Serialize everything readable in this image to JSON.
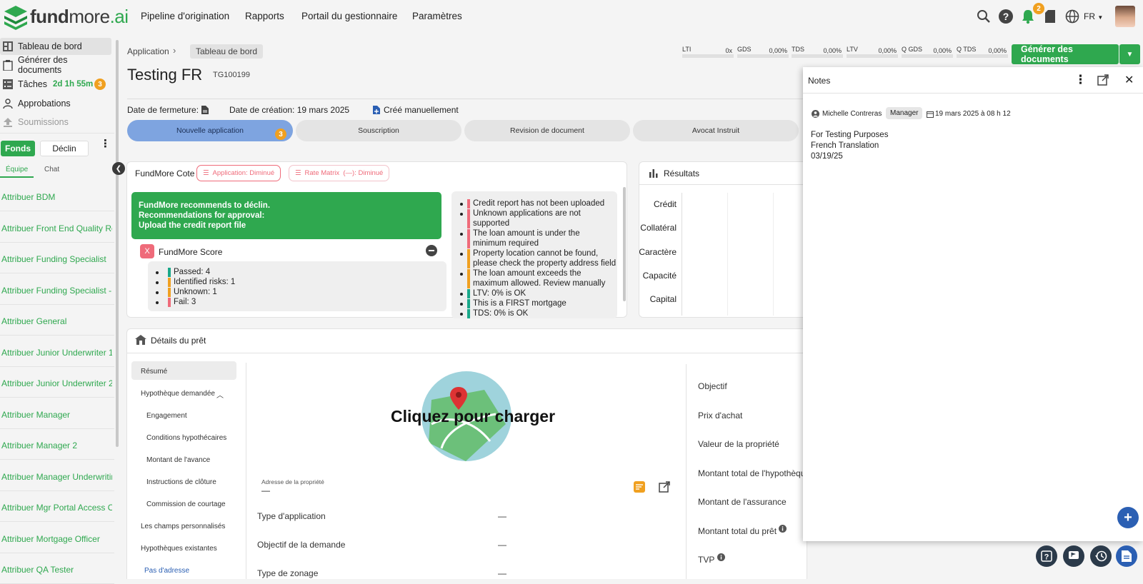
{
  "brand": {
    "name_bold": "fund",
    "name_mid": "more",
    "name_ai": ".ai"
  },
  "topnav": [
    "Pipeline d'origination",
    "Rapports",
    "Portail du gestionnaire",
    "Paramètres"
  ],
  "header_right": {
    "notif_count": "2",
    "lang": "FR"
  },
  "sidebar": {
    "items": [
      "Tableau de bord",
      "Générer des documents",
      "Tâches",
      "Approbations",
      "Soumissions"
    ],
    "tasks_timer": "2d 1h 55m",
    "tasks_count": "3",
    "fund_btn": "Fonds",
    "decline_btn": "Déclin",
    "tabs": [
      "Équipe",
      "Chat"
    ],
    "assignees": [
      "Attribuer BDM",
      "Attribuer Front End Quality Review",
      "Attribuer Funding Specialist",
      "Attribuer Funding Specialist - c",
      "Attribuer General",
      "Attribuer Junior Underwriter 1",
      "Attribuer Junior Underwriter 2",
      "Attribuer Manager",
      "Attribuer Manager 2",
      "Attribuer Manager Underwriting",
      "Attribuer Mgr Portal Access Only",
      "Attribuer Mortgage Officer",
      "Attribuer QA Tester"
    ]
  },
  "breadcrumb": {
    "root": "Application",
    "current": "Tableau de bord"
  },
  "ratios": [
    {
      "label": "LTI",
      "value": "0x"
    },
    {
      "label": "GDS",
      "value": "0,00%"
    },
    {
      "label": "TDS",
      "value": "0,00%"
    },
    {
      "label": "LTV",
      "value": "0,00%"
    },
    {
      "label": "Q GDS",
      "value": "0,00%"
    },
    {
      "label": "Q TDS",
      "value": "0,00%"
    }
  ],
  "generate_btn": "Générer des documents",
  "app": {
    "title": "Testing FR",
    "code": "TG100199",
    "closing_label": "Date de fermeture:",
    "created_label": "Date de création: 19 mars 2025",
    "manual_label": "Créé manuellement"
  },
  "stages": [
    {
      "label": "Nouvelle application",
      "count": "3"
    },
    {
      "label": "Souscription"
    },
    {
      "label": "Revision de document"
    },
    {
      "label": "Avocat Instruit"
    }
  ],
  "fundmore": {
    "title": "FundMore Cote",
    "chip1_label": "Application:",
    "chip1_value": "Diminué",
    "chip2_label": "Rate Matrix",
    "chip2_mid": "(—):",
    "chip2_value": "Diminué",
    "rec_lines": [
      "FundMore recommends to déclin.",
      "Recommendations for approval:",
      "Upload the credit report file"
    ],
    "score_title": "FundMore Score",
    "score_x": "X",
    "score_items": [
      {
        "text": "Passed: 4",
        "color": "#1aa88a"
      },
      {
        "text": "Identified risks: 1",
        "color": "#f0a020"
      },
      {
        "text": "Unknown: 1",
        "color": "#f0a020"
      },
      {
        "text": "Fail: 3",
        "color": "#ef6b7a"
      }
    ],
    "checks": [
      {
        "lines": [
          "Credit report has not been uploaded"
        ],
        "color": "#ef6b7a"
      },
      {
        "lines": [
          "Unknown applications are not",
          "supported"
        ],
        "color": "#ef6b7a"
      },
      {
        "lines": [
          "The loan amount is under the",
          "minimum required"
        ],
        "color": "#ef6b7a"
      },
      {
        "lines": [
          "Property location cannot be found,",
          "please check the property address field"
        ],
        "color": "#f0a020"
      },
      {
        "lines": [
          "The loan amount exceeds the",
          "maximum allowed. Review manually"
        ],
        "color": "#f0a020"
      },
      {
        "lines": [
          "LTV: 0% is OK"
        ],
        "color": "#1aa88a"
      },
      {
        "lines": [
          "This is a FIRST mortgage"
        ],
        "color": "#1aa88a"
      },
      {
        "lines": [
          "TDS: 0% is OK"
        ],
        "color": "#1aa88a"
      }
    ]
  },
  "results": {
    "title": "Résultats",
    "rows": [
      "Crédit",
      "Collatéral",
      "Caractère",
      "Capacité",
      "Capital"
    ]
  },
  "loan": {
    "title": "Détails du prêt",
    "subnav": [
      "Résumé",
      "Hypothèque demandée",
      "Engagement",
      "Conditions hypothécaires",
      "Montant de l'avance",
      "Instructions de clôture",
      "Commission de courtage",
      "Les champs personnalisés",
      "Hypothèques existantes",
      "Pas d'adresse"
    ],
    "map_label": "Cliquez pour charger",
    "address_label": "Adresse de la propriété",
    "address_value": "—",
    "fields_left": [
      {
        "label": "Type d'application",
        "value": "—"
      },
      {
        "label": "Objectif de la demande",
        "value": "—"
      },
      {
        "label": "Type de zonage",
        "value": "—"
      }
    ],
    "fields_right": [
      "Objectif",
      "Prix d'achat",
      "Valeur de la propriété",
      "Montant total de l'hypothèque",
      "Montant de l'assurance",
      "Montant total du prêt",
      "TVP"
    ]
  },
  "notes": {
    "title": "Notes",
    "author": "Michelle Contreras",
    "role": "Manager",
    "date": "19 mars 2025 à 08 h 12",
    "lines": [
      "For Testing Purposes",
      "French Translation",
      "03/19/25"
    ]
  },
  "colors": {
    "brand_green": "#2fa84f",
    "stage_active": "#7ea4e0",
    "warn": "#f0a020",
    "fail": "#ef6b7a",
    "pass": "#1aa88a"
  }
}
